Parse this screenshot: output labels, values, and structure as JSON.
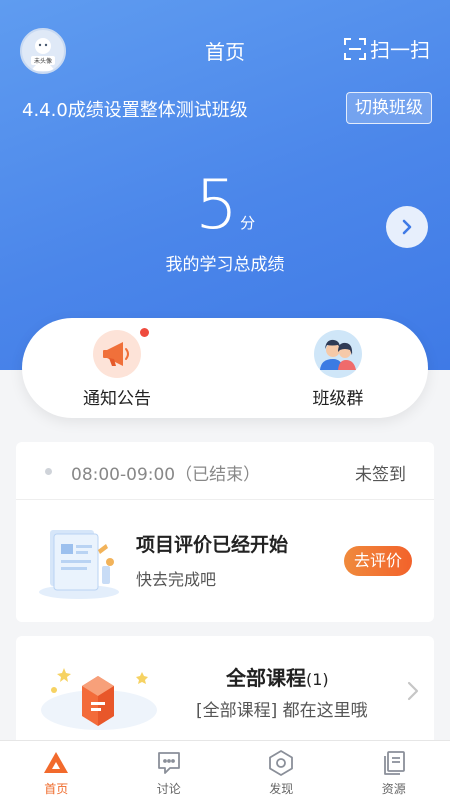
{
  "header": {
    "title": "首页",
    "scan_label": "扫一扫",
    "avatar_text": "未头像"
  },
  "class_info": {
    "name": "4.4.0成绩设置整体测试班级",
    "switch_label": "切换班级"
  },
  "score": {
    "value": "5",
    "unit": "分",
    "label": "我的学习总成绩"
  },
  "quick_actions": [
    {
      "label": "通知公告",
      "icon": "megaphone-icon",
      "has_badge": true
    },
    {
      "label": "班级群",
      "icon": "group-chat-icon",
      "has_badge": false
    }
  ],
  "schedule": {
    "time": "08:00-09:00（已结束）",
    "status": "未签到"
  },
  "evaluation": {
    "title": "项目评价已经开始",
    "subtitle": "快去完成吧",
    "button_label": "去评价"
  },
  "courses": {
    "title": "全部课程",
    "count": "(1)",
    "subtitle": "[全部课程] 都在这里哦"
  },
  "tabbar": [
    {
      "label": "首页",
      "icon": "home-icon",
      "active": true
    },
    {
      "label": "讨论",
      "icon": "discussion-icon",
      "active": false
    },
    {
      "label": "发现",
      "icon": "discover-icon",
      "active": false
    },
    {
      "label": "资源",
      "icon": "resources-icon",
      "active": false
    }
  ],
  "colors": {
    "hero_blue": "#4b86ea",
    "accent_orange": "#f2622b",
    "badge_red": "#ef4b3e"
  }
}
